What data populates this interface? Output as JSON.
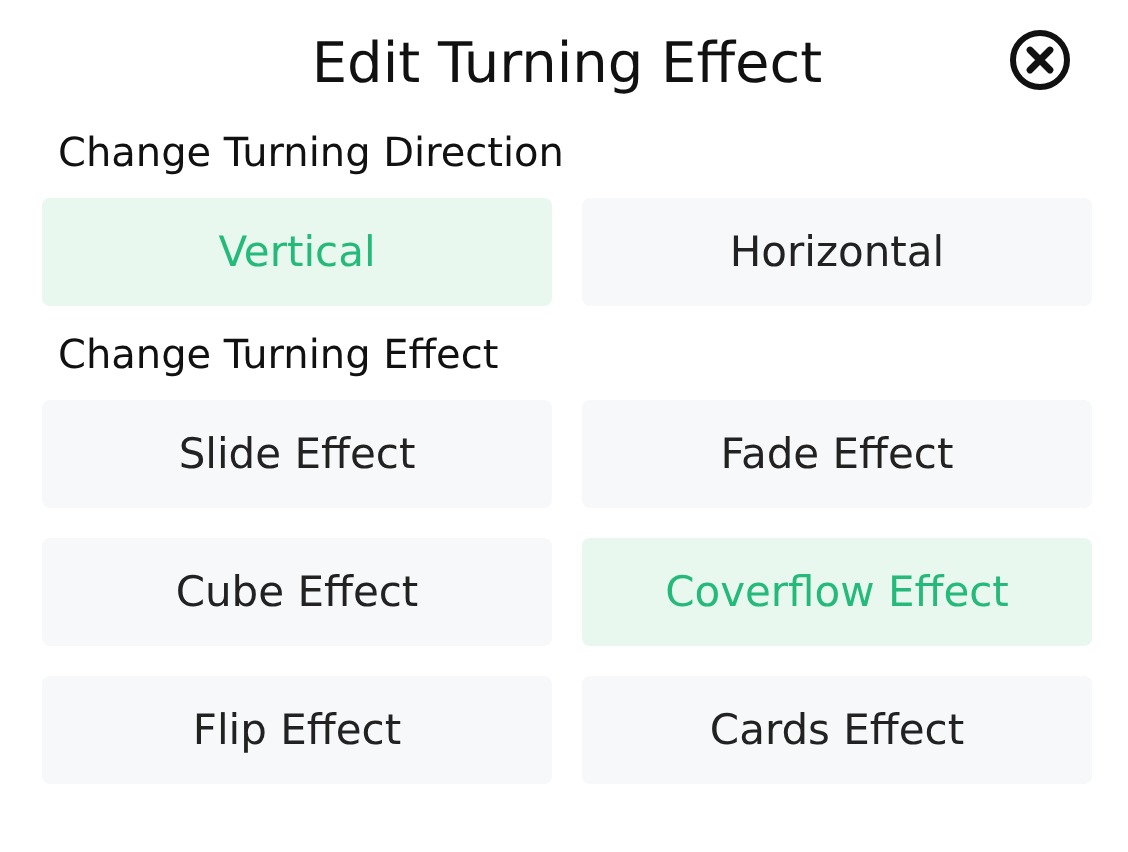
{
  "dialog": {
    "title": "Edit Turning Effect"
  },
  "sections": [
    {
      "heading": "Change Turning Direction",
      "options": [
        {
          "label": "Vertical",
          "selected": true
        },
        {
          "label": "Horizontal",
          "selected": false
        }
      ]
    },
    {
      "heading": "Change Turning Effect",
      "options": [
        {
          "label": "Slide Effect",
          "selected": false
        },
        {
          "label": "Fade Effect",
          "selected": false
        },
        {
          "label": "Cube Effect",
          "selected": false
        },
        {
          "label": "Coverflow Effect",
          "selected": true
        },
        {
          "label": "Flip Effect",
          "selected": false
        },
        {
          "label": "Cards Effect",
          "selected": false
        }
      ]
    }
  ]
}
